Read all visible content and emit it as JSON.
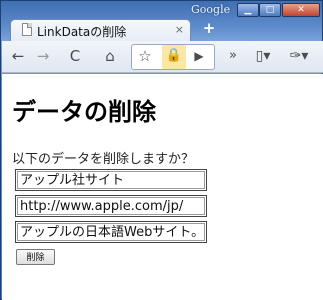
{
  "window": {
    "brand": "Google",
    "min_icon": "minimize-icon",
    "max_icon": "maximize-icon",
    "close_icon": "close-icon",
    "min_glyph": "▁",
    "max_glyph": "□",
    "close_glyph": "✕"
  },
  "tab": {
    "title": "LinkDataの削除",
    "close_glyph": "×",
    "new_tab_glyph": "+"
  },
  "toolbar": {
    "back_glyph": "←",
    "forward_glyph": "→",
    "reload_glyph": "C",
    "home_glyph": "⌂",
    "star_glyph": "☆",
    "lock_glyph": "🔒",
    "play_glyph": "▶",
    "more_glyph": "»",
    "page_glyph": "▯▾",
    "wrench_glyph": "✑▾"
  },
  "page": {
    "heading": "データの削除",
    "prompt": "以下のデータを削除しますか？",
    "fields": [
      "アップル社サイト",
      "http://www.apple.com/jp/",
      "アップルの日本語Webサイト。"
    ],
    "delete_button": "削除"
  }
}
